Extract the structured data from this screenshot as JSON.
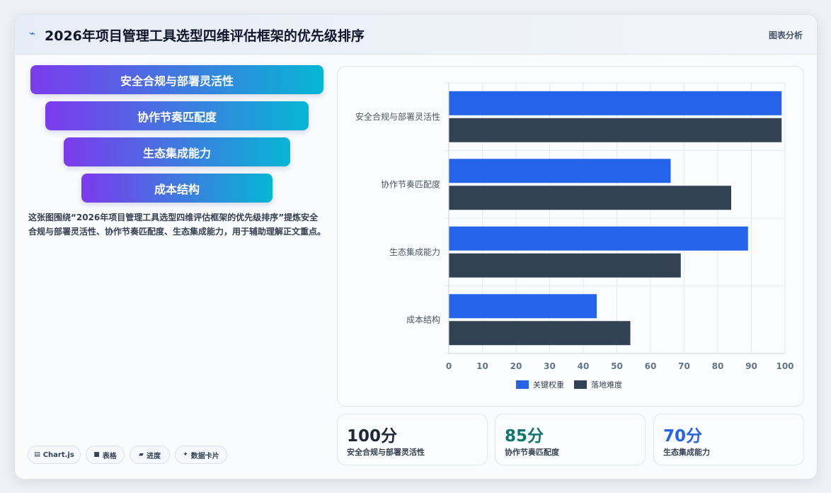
{
  "header": {
    "icon": "trend-icon",
    "title": "2026年项目管理工具选型四维评估框架的优先级排序",
    "tag": "图表分析"
  },
  "funnel": [
    "安全合规与部署灵活性",
    "协作节奏匹配度",
    "生态集成能力",
    "成本结构"
  ],
  "description": "这张图围绕“2026年项目管理工具选型四维评估框架的优先级排序”提炼安全合规与部署灵活性、协作节奏匹配度、生态集成能力，用于辅助理解正文重点。",
  "chips": [
    {
      "icon": "▤",
      "label": "Chart.js"
    },
    {
      "icon": "■",
      "label": "表格"
    },
    {
      "icon": "▰",
      "label": "进度"
    },
    {
      "icon": "✦",
      "label": "数据卡片"
    }
  ],
  "stats": [
    {
      "value": "100分",
      "label": "安全合规与部署灵活性",
      "color": "#1f2937"
    },
    {
      "value": "85分",
      "label": "协作节奏匹配度",
      "color": "#0f766e"
    },
    {
      "value": "70分",
      "label": "生态集成能力",
      "color": "#2563eb"
    }
  ],
  "colors": {
    "series1": "#2563eb",
    "series2": "#334155"
  },
  "chart_data": {
    "type": "bar",
    "orientation": "horizontal",
    "categories": [
      "安全合规与部署灵活性",
      "协作节奏匹配度",
      "生态集成能力",
      "成本结构"
    ],
    "series": [
      {
        "name": "关键权重",
        "values": [
          99,
          66,
          89,
          44
        ],
        "color": "#2563eb"
      },
      {
        "name": "落地难度",
        "values": [
          99,
          84,
          69,
          54
        ],
        "color": "#334155"
      }
    ],
    "xlim": [
      0,
      100
    ],
    "xticks": [
      0,
      10,
      20,
      30,
      40,
      50,
      60,
      70,
      80,
      90,
      100
    ],
    "grid": true,
    "legend": "bottom"
  }
}
